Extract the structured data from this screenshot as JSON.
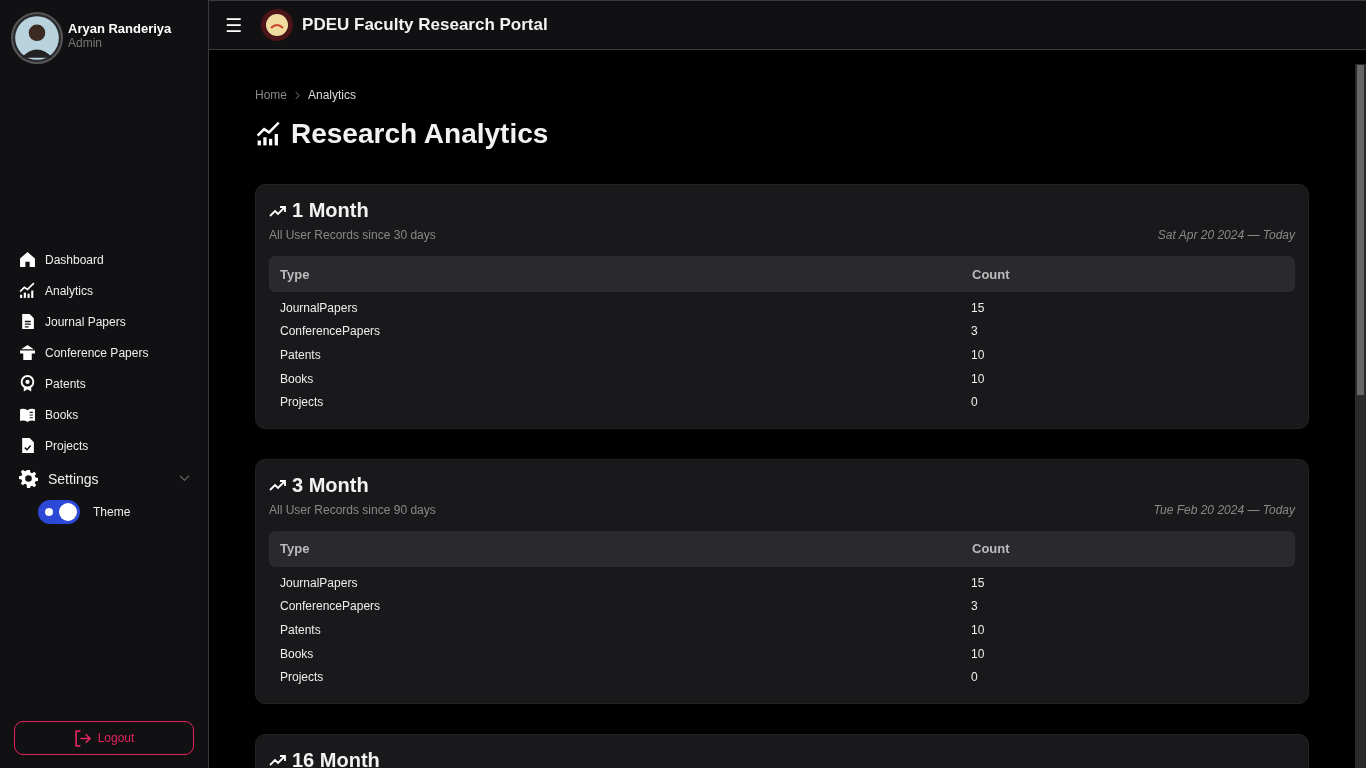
{
  "user": {
    "name": "Aryan Randeriya",
    "role": "Admin"
  },
  "nav": [
    {
      "label": "Dashboard"
    },
    {
      "label": "Analytics"
    },
    {
      "label": "Journal Papers"
    },
    {
      "label": "Conference Papers"
    },
    {
      "label": "Patents"
    },
    {
      "label": "Books"
    },
    {
      "label": "Projects"
    }
  ],
  "settings": {
    "label": "Settings",
    "expanded": true,
    "theme": {
      "label": "Theme",
      "on": true
    }
  },
  "logout": "Logout",
  "header": {
    "menu": "☰",
    "title": "PDEU Faculty Research Portal"
  },
  "breadcrumb": [
    "Home",
    "Analytics"
  ],
  "page_title": "Research Analytics",
  "cards": [
    {
      "title": "1 Month",
      "subtitle": "All User Records since 30 days",
      "range": "Sat Apr 20 2024 — Today",
      "columns": [
        "Type",
        "Count"
      ],
      "rows": [
        [
          "JournalPapers",
          "15"
        ],
        [
          "ConferencePapers",
          "3"
        ],
        [
          "Patents",
          "10"
        ],
        [
          "Books",
          "10"
        ],
        [
          "Projects",
          "0"
        ]
      ]
    },
    {
      "title": "3 Month",
      "subtitle": "All User Records since 90 days",
      "range": "Tue Feb 20 2024 — Today",
      "columns": [
        "Type",
        "Count"
      ],
      "rows": [
        [
          "JournalPapers",
          "15"
        ],
        [
          "ConferencePapers",
          "3"
        ],
        [
          "Patents",
          "10"
        ],
        [
          "Books",
          "10"
        ],
        [
          "Projects",
          "0"
        ]
      ]
    },
    {
      "title": "16 Month"
    }
  ]
}
